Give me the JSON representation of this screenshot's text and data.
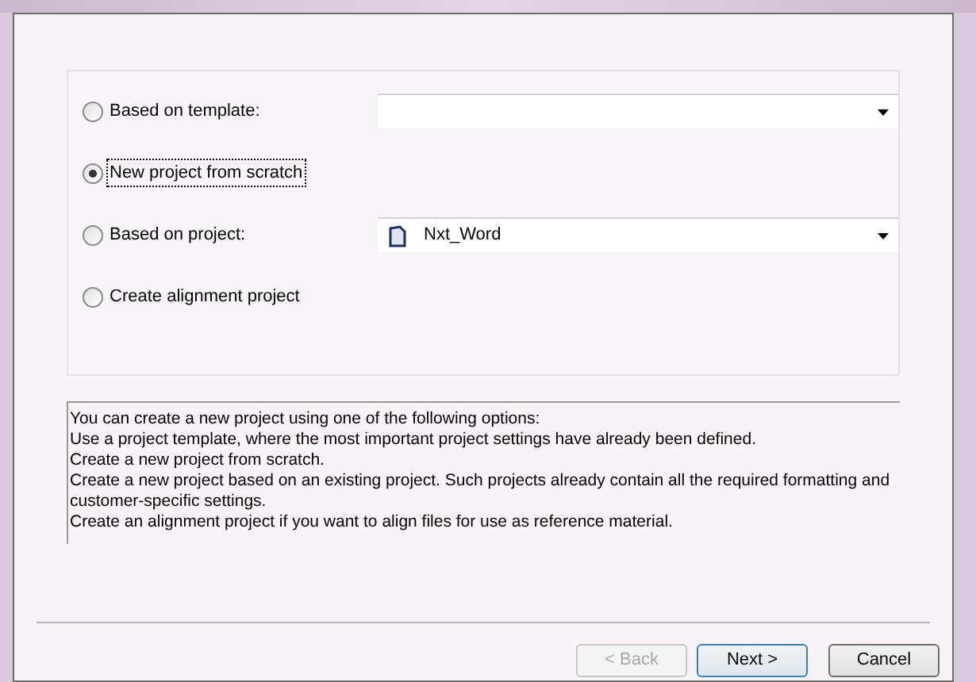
{
  "options": [
    {
      "label": "Based on template:",
      "selected": false,
      "focused": false,
      "kind": "combo"
    },
    {
      "label": "New project from scratch",
      "selected": true,
      "focused": true,
      "kind": "plain"
    },
    {
      "label": "Based on project:",
      "selected": false,
      "focused": false,
      "kind": "combo",
      "combo": {
        "value": "Nxt_Word"
      }
    },
    {
      "label": "Create alignment project",
      "selected": false,
      "focused": false,
      "kind": "plain"
    }
  ],
  "description": [
    "You can create a new project using one of the following options:",
    "Use a project template, where the most important project settings have already been defined.",
    "Create a new project from scratch.",
    "Create a new project based on an existing project. Such projects already contain all the required formatting and customer-specific settings.",
    "Create an alignment project if you want to align files for use as reference material."
  ],
  "buttons": [
    {
      "label": "< Back",
      "disabled": true,
      "default": false
    },
    {
      "label": "Next >",
      "disabled": false,
      "default": true
    },
    {
      "label": "Cancel",
      "disabled": false,
      "default": false
    }
  ]
}
